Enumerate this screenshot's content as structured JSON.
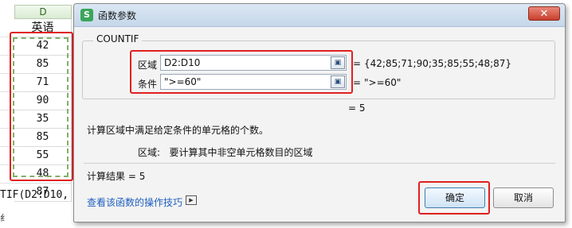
{
  "sheet": {
    "column_letter": "D",
    "header_cell": "英语",
    "values": [
      "42",
      "85",
      "71",
      "90",
      "35",
      "85",
      "55",
      "48",
      "87"
    ],
    "formula_fragment": "TIF(D2:D10,",
    "below_fragment": "纟",
    "highlight_color": "#e02020"
  },
  "dialog": {
    "title": "函数参数",
    "app_icon": "S",
    "close_icon": "close-icon",
    "function_name": "COUNTIF",
    "args": [
      {
        "label": "区域",
        "value": "D2:D10",
        "result": "{42;85;71;90;35;85;55;48;87}"
      },
      {
        "label": "条件",
        "value": "\">=60\"",
        "result": "\">=60\""
      }
    ],
    "formula_result": "5",
    "description": "计算区域中满足给定条件的单元格的个数。",
    "param_desc_label": "区域:",
    "param_desc_text": "要计算其中非空单元格数目的区域",
    "calc_result_label": "计算结果 =",
    "calc_result_value": "5",
    "help_link": "查看该函数的操作技巧",
    "ok_label": "确定",
    "cancel_label": "取消"
  }
}
